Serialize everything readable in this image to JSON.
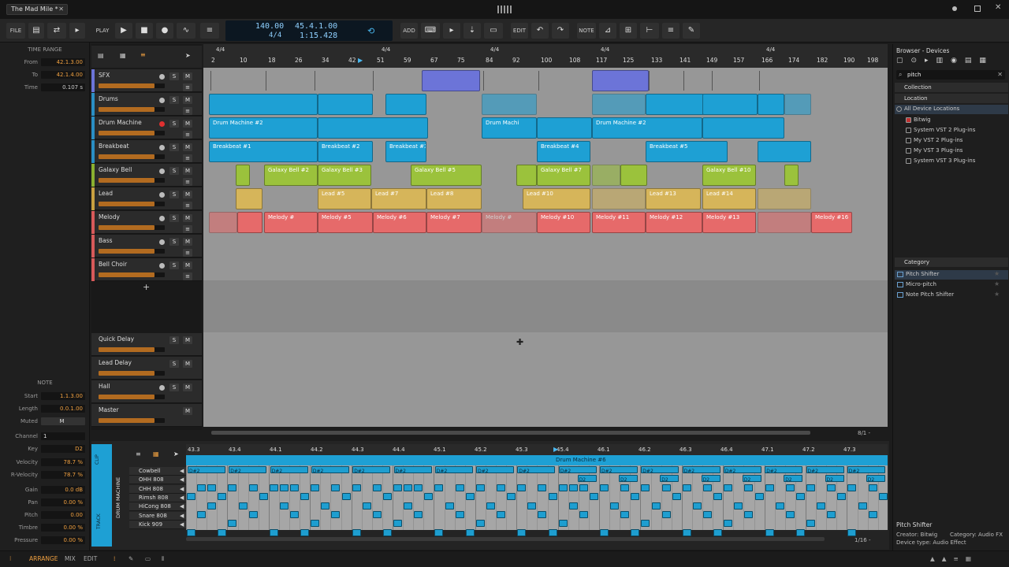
{
  "window": {
    "title": "The Mad Mile *"
  },
  "toolbar": {
    "file": "FILE",
    "play": "PLAY",
    "add": "ADD",
    "edit": "EDIT",
    "note": "NOTE",
    "tempo": "140.00",
    "timesig": "4/4",
    "position": "45.4.1.00",
    "time": "1:15.428"
  },
  "time_range": {
    "head": "TIME RANGE",
    "from_label": "From",
    "from": "42.1.3.00",
    "to_label": "To",
    "to": "42.1.4.00",
    "time_label": "Time",
    "time": "0.107 s"
  },
  "note_panel": {
    "head": "NOTE",
    "start_label": "Start",
    "start": "1.1.3.00",
    "length_label": "Length",
    "length": "0.0.1.00",
    "muted_label": "Muted",
    "muted": "M",
    "channel_label": "Channel",
    "channel": "1",
    "key_label": "Key",
    "key": "D2",
    "velocity_label": "Velocity",
    "velocity": "78.7 %",
    "rvelocity_label": "R-Velocity",
    "rvelocity": "78.7 %",
    "gain_label": "Gain",
    "gain": "0.0 dB",
    "pan_label": "Pan",
    "pan": "0.00 %",
    "pitch_label": "Pitch",
    "pitch": "0.00",
    "timbre_label": "Timbre",
    "timbre": "0.00 %",
    "pressure_label": "Pressure",
    "pressure": "0.00 %"
  },
  "ruler": {
    "marks": [
      "2",
      "10",
      "18",
      "26",
      "34",
      "42",
      "51",
      "59",
      "67",
      "75",
      "84",
      "92",
      "100",
      "108",
      "117",
      "125",
      "133",
      "141",
      "149",
      "157",
      "166",
      "174",
      "182",
      "190",
      "198"
    ],
    "sigs": [
      "4/4",
      "4/4",
      "4/4",
      "4/4",
      "4/4"
    ]
  },
  "tracks": [
    {
      "name": "SFX",
      "color": "#6c74d8",
      "level": 0.85
    },
    {
      "name": "Drums",
      "color": "#2a8fc4",
      "level": 0.85
    },
    {
      "name": "Drum Machine",
      "color": "#2a8fc4",
      "level": 0.85
    },
    {
      "name": "Breakbeat",
      "color": "#2a8fc4",
      "level": 0.85
    },
    {
      "name": "Galaxy Bell",
      "color": "#8ab030",
      "level": 0.85
    },
    {
      "name": "Lead",
      "color": "#c9a040",
      "level": 0.85
    },
    {
      "name": "Melody",
      "color": "#d85a5a",
      "level": 0.85
    },
    {
      "name": "Bass",
      "color": "#d85a5a",
      "level": 0.85
    },
    {
      "name": "Bell Choir",
      "color": "#d85a5a",
      "level": 0.85
    }
  ],
  "fx_tracks": [
    {
      "name": "Quick Delay"
    },
    {
      "name": "Lead Delay"
    },
    {
      "name": "Hall"
    },
    {
      "name": "Master"
    }
  ],
  "buttons": {
    "solo": "S",
    "mute": "M",
    "add_track": "+"
  },
  "clips": {
    "drum_machine": [
      "Drum Machine #2",
      "Drum Machi",
      "Drum Machine #2"
    ],
    "breakbeat": [
      "Breakbeat #1",
      "Breakbeat #2",
      "Breakbeat #3",
      "Breakbeat #4",
      "Breakbeat #5"
    ],
    "galaxy": [
      "Galaxy Bell #2",
      "Galaxy Bell #3",
      "Galaxy Bell #5",
      "Galaxy Bell #7",
      "Galaxy Bell #10"
    ],
    "lead": [
      "Lead #5",
      "Lead #7",
      "Lead #8",
      "Lead #10",
      "Lead #13",
      "Lead #14"
    ],
    "melody": [
      "Melody #",
      "Melody #5",
      "Melody #6",
      "Melody #7",
      "Melody #",
      "Melody #10",
      "Melody #11",
      "Melody #12",
      "Melody #13",
      "Melody #16"
    ]
  },
  "browser": {
    "title": "Browser - Devices",
    "search": "pitch",
    "collection": "Collection",
    "location": "Location",
    "locations": [
      "All Device Locations",
      "Bitwig",
      "System VST 2 Plug-ins",
      "My VST 2 Plug-ins",
      "My VST 3 Plug-ins",
      "System VST 3 Plug-ins"
    ],
    "category": "Category",
    "results": [
      "Pitch Shifter",
      "Micro-pitch",
      "Note Pitch Shifter"
    ],
    "info_title": "Pitch Shifter",
    "creator": "Creator: Bitwig",
    "category_info": "Category: Audio FX",
    "device_type": "Device type: Audio Effect"
  },
  "editor": {
    "clip_name": "Drum Machine #6",
    "track_label": "DRUM MACHINE",
    "clip_side": "CLIP",
    "track_side": "TRACK",
    "ruler": [
      "43.3",
      "43.4",
      "44.1",
      "44.2",
      "44.3",
      "44.4",
      "45.1",
      "45.2",
      "45.3",
      "45.4",
      "46.1",
      "46.2",
      "46.3",
      "46.4",
      "47.1",
      "47.2",
      "47.3"
    ],
    "keys": [
      "Cowbell",
      "OHH 808",
      "CHH 808",
      "Rimsh 808",
      "HiCong 808",
      "Snare 808",
      "Kick 909"
    ],
    "note_label": "D#2",
    "note_label2": "D2",
    "grid": "1/16 -",
    "zoom": "8/1 -"
  },
  "bottom": {
    "arrange": "ARRANGE",
    "mix": "MIX",
    "edit": "EDIT"
  },
  "colors": {
    "accent": "#f0a040",
    "drum": "#1ea0d4",
    "galaxy": "#9bc23c",
    "lead": "#d6b55a",
    "melody": "#e66a6a",
    "sfx": "#6c74d8"
  }
}
